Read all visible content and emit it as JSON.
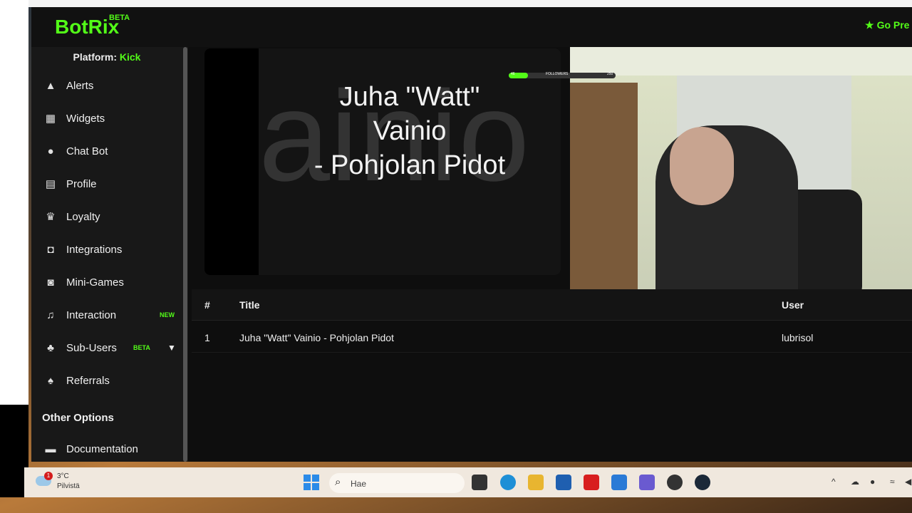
{
  "app": {
    "logo": "BotRix",
    "logo_badge": "BETA",
    "go_premium": "Go Pre",
    "platform_label": "Platform:",
    "platform_value": "Kick"
  },
  "sidebar": {
    "items": [
      {
        "label": "Alerts",
        "icon": "warning-icon"
      },
      {
        "label": "Widgets",
        "icon": "grid-icon"
      },
      {
        "label": "Chat Bot",
        "icon": "robot-icon"
      },
      {
        "label": "Profile",
        "icon": "id-card-icon"
      },
      {
        "label": "Loyalty",
        "icon": "trophy-icon"
      },
      {
        "label": "Integrations",
        "icon": "plug-icon"
      },
      {
        "label": "Mini-Games",
        "icon": "gamepad-icon"
      },
      {
        "label": "Interaction",
        "icon": "music-note-icon",
        "badge": "NEW"
      },
      {
        "label": "Sub-Users",
        "icon": "users-icon",
        "badge": "BETA"
      },
      {
        "label": "Referrals",
        "icon": "user-group-icon"
      }
    ],
    "section_title": "Other Options",
    "documentation": "Documentation"
  },
  "video": {
    "title_line1": "Juha \"Watt\"",
    "title_line2": "Vainio",
    "title_line3": "- Pohjolan Pidot",
    "bg_text": "ainio - Po"
  },
  "overlay": {
    "followers_label": "FOLLOWERS",
    "followers_left": "46",
    "followers_right": "250",
    "followers_progress": 0.18
  },
  "table": {
    "headers": [
      "#",
      "Title",
      "User"
    ],
    "rows": [
      {
        "num": "1",
        "title": "Juha \"Watt\" Vainio - Pohjolan Pidot",
        "user": "lubrisol"
      }
    ]
  },
  "taskbar": {
    "temperature": "3°C",
    "condition": "Pilvistä",
    "weather_badge": "1",
    "search_placeholder": "Hae"
  },
  "colors": {
    "accent": "#53fc18",
    "app_bg": "#111111",
    "sidebar_bg": "#181818"
  }
}
